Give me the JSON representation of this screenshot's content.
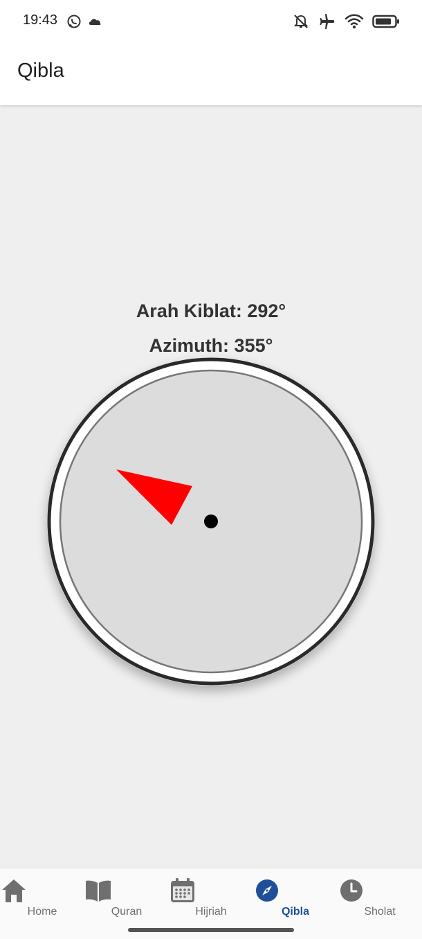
{
  "status_bar": {
    "time": "19:43",
    "left_icons": [
      "whatsapp-icon",
      "cloud-icon"
    ],
    "right_icons": [
      "mute-icon",
      "airplane-icon",
      "wifi-icon",
      "battery-icon"
    ]
  },
  "app_bar": {
    "title": "Qibla"
  },
  "qibla": {
    "direction_text": "Arah Kiblat: 292°",
    "azimuth_text": "Azimuth: 355°",
    "pointer_color": "#ff0000",
    "dial_color": "#dcdcdc"
  },
  "bottom_nav": {
    "items": [
      {
        "label": "Home",
        "icon": "home-icon",
        "active": false
      },
      {
        "label": "Quran",
        "icon": "book-icon",
        "active": false
      },
      {
        "label": "Hijriah",
        "icon": "calendar-icon",
        "active": false
      },
      {
        "label": "Qibla",
        "icon": "compass-icon",
        "active": true
      },
      {
        "label": "Sholat",
        "icon": "clock-icon",
        "active": false
      }
    ],
    "active_color": "#1f4f9a",
    "inactive_color": "#6f6f6f"
  }
}
